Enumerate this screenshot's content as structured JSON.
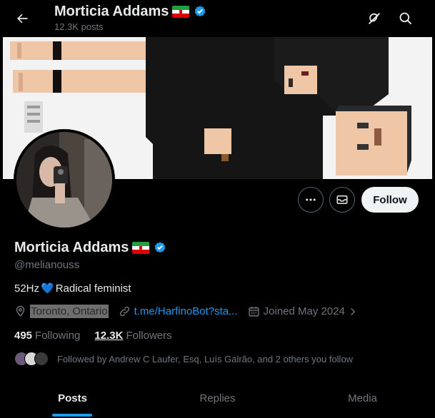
{
  "header": {
    "title": "Morticia Addams",
    "post_count": "12.3K posts"
  },
  "profile": {
    "name": "Morticia Addams",
    "handle": "@melianouss",
    "bio_prefix": "52Hz",
    "bio_heart": "💙",
    "bio_suffix": " Radical feminist",
    "location": "Toronto, Ontario",
    "link": "t.me/HarfinoBot?sta...",
    "joined": "Joined May 2024",
    "following_count": "495",
    "following_label": "Following",
    "followers_count": "12.3K",
    "followers_label": "Followers",
    "followed_by": "Followed by Andrew C Laufer, Esq, Luís Galrão, and 2 others you follow"
  },
  "actions": {
    "follow_label": "Follow"
  },
  "tabs": [
    {
      "label": "Posts",
      "active": true
    },
    {
      "label": "Replies",
      "active": false
    },
    {
      "label": "Media",
      "active": false
    }
  ],
  "colors": {
    "accent": "#1d9bf0",
    "background": "#000000",
    "muted_text": "#71767b",
    "primary_text": "#e7e9ea"
  },
  "icons": [
    "back-arrow-icon",
    "iran-flag-icon",
    "verified-badge-icon",
    "grok-icon",
    "search-icon",
    "more-icon",
    "message-icon",
    "location-icon",
    "link-icon",
    "calendar-icon",
    "chevron-right-icon"
  ]
}
